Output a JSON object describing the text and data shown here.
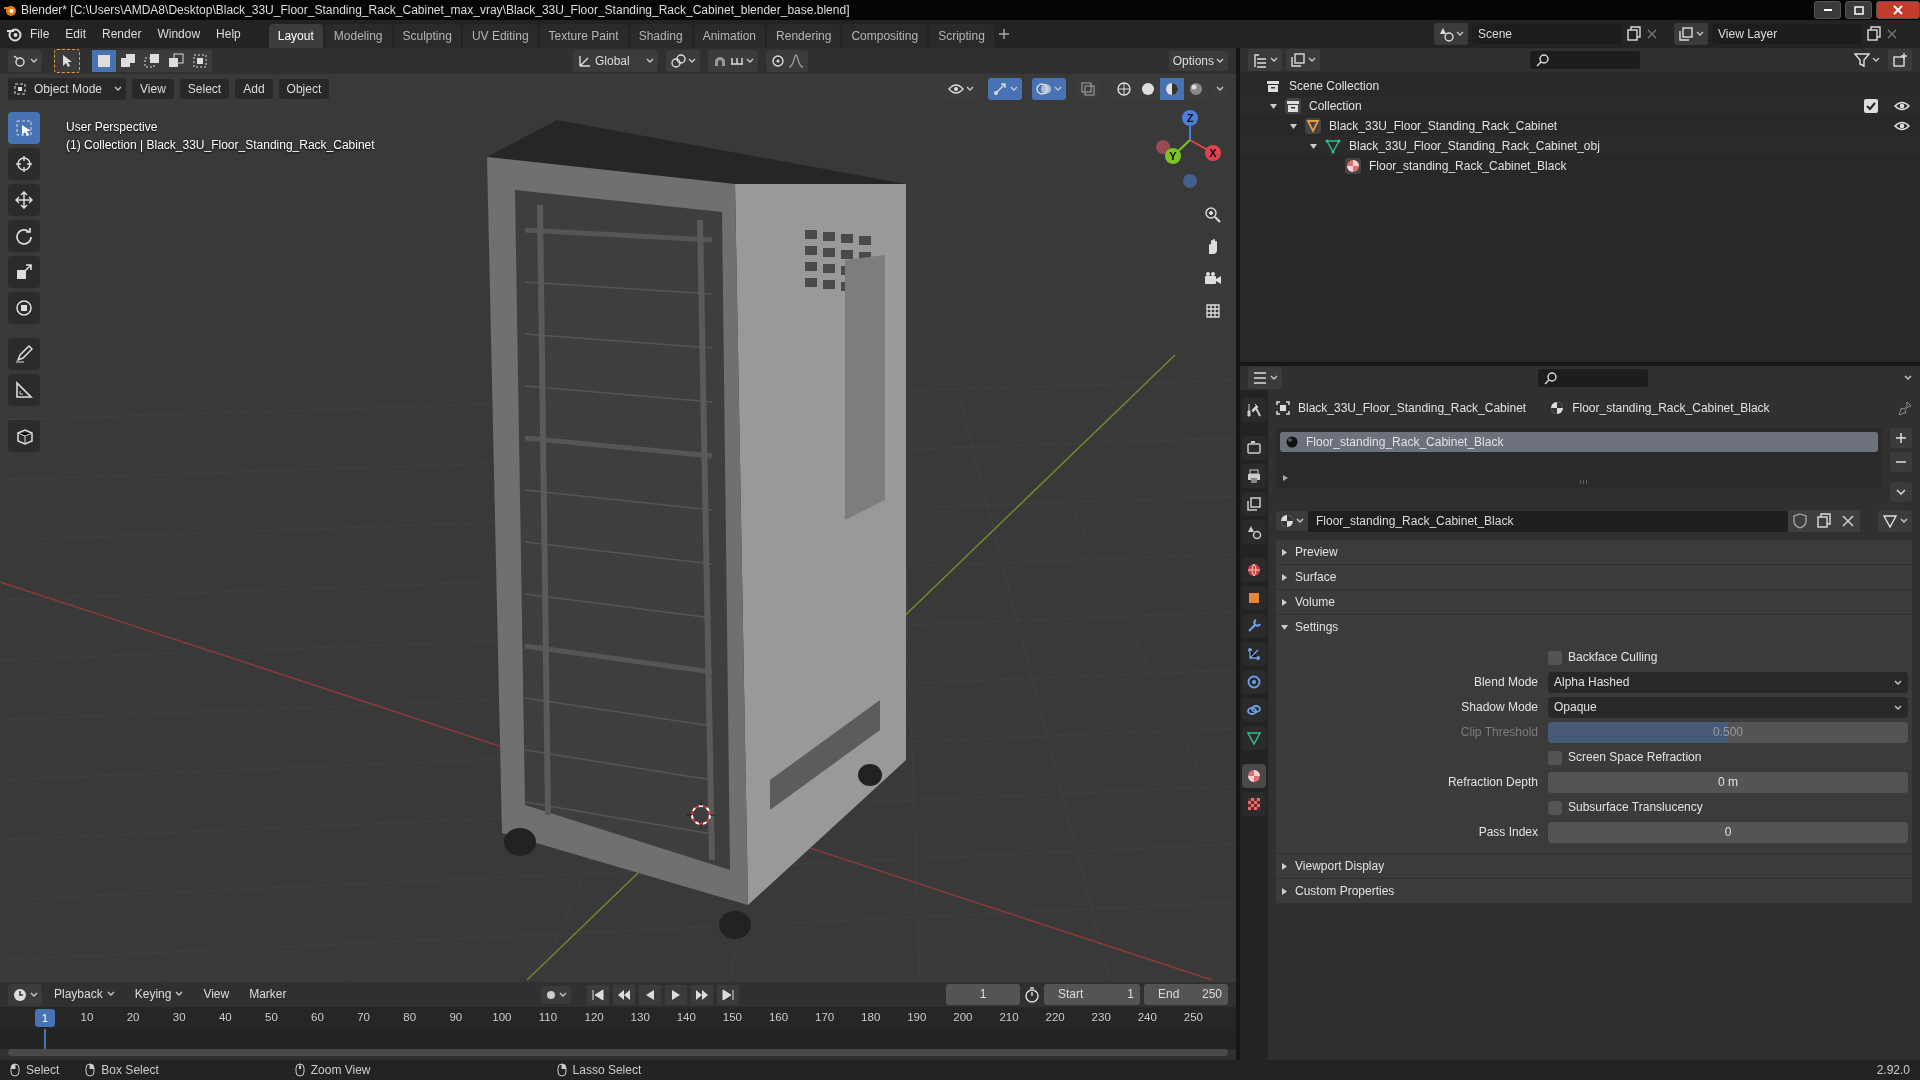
{
  "window": {
    "title": "Blender* [C:\\Users\\AMDA8\\Desktop\\Black_33U_Floor_Standing_Rack_Cabinet_max_vray\\Black_33U_Floor_Standing_Rack_Cabinet_blender_base.blend]"
  },
  "menu": [
    "File",
    "Edit",
    "Render",
    "Window",
    "Help"
  ],
  "workspaces": [
    {
      "label": "Layout",
      "selected": true
    },
    {
      "label": "Modeling",
      "selected": false
    },
    {
      "label": "Sculpting",
      "selected": false
    },
    {
      "label": "UV Editing",
      "selected": false
    },
    {
      "label": "Texture Paint",
      "selected": false
    },
    {
      "label": "Shading",
      "selected": false
    },
    {
      "label": "Animation",
      "selected": false
    },
    {
      "label": "Rendering",
      "selected": false
    },
    {
      "label": "Compositing",
      "selected": false
    },
    {
      "label": "Scripting",
      "selected": false
    }
  ],
  "scene": "Scene",
  "view_layer": "View Layer",
  "tool_header": {
    "select_modes": [
      {
        "kind": "set",
        "selected": true
      },
      {
        "kind": "extend",
        "selected": false
      },
      {
        "kind": "subtract",
        "selected": false
      },
      {
        "kind": "invert",
        "selected": false
      },
      {
        "kind": "intersect",
        "selected": false
      }
    ],
    "orientation": "Global",
    "options": "Options"
  },
  "viewport_header": {
    "mode": "Object Mode",
    "menus": [
      "View",
      "Select",
      "Add",
      "Object"
    ],
    "toggles": [
      {
        "kind": "visibility",
        "on": false
      },
      {
        "kind": "gizmo",
        "on": true
      },
      {
        "kind": "overlay",
        "on": true
      },
      {
        "kind": "xray",
        "on": false
      }
    ],
    "shading": [
      {
        "kind": "wireframe",
        "selected": false
      },
      {
        "kind": "solid",
        "selected": false
      },
      {
        "kind": "material",
        "selected": true
      },
      {
        "kind": "rendered",
        "selected": false
      }
    ]
  },
  "viewport": {
    "perspective": "User Perspective",
    "info": "(1) Collection | Black_33U_Floor_Standing_Rack_Cabinet",
    "axes": [
      "X",
      "Y",
      "Z"
    ]
  },
  "toolbar": [
    {
      "kind": "select",
      "selected": true
    },
    {
      "kind": "cursor",
      "selected": false
    },
    {
      "kind": "move",
      "selected": false
    },
    {
      "kind": "rotate",
      "selected": false
    },
    {
      "kind": "scale",
      "selected": false
    },
    {
      "kind": "transform",
      "selected": false
    },
    {
      "kind": "annotate",
      "selected": false
    },
    {
      "kind": "measure",
      "selected": false
    },
    {
      "kind": "add-cube",
      "selected": false
    }
  ],
  "outliner": {
    "tree": [
      {
        "label": "Scene Collection",
        "kind": "scene",
        "visible": false,
        "children": [
          {
            "label": "Collection",
            "kind": "collection",
            "expanded": true,
            "checked": true,
            "visible": true,
            "children": [
              {
                "label": "Black_33U_Floor_Standing_Rack_Cabinet",
                "kind": "object",
                "expanded": true,
                "visible": true,
                "children": [
                  {
                    "label": "Black_33U_Floor_Standing_Rack_Cabinet_obj",
                    "kind": "mesh",
                    "expanded": true,
                    "visible": false,
                    "children": [
                      {
                        "label": "Floor_standing_Rack_Cabinet_Black",
                        "kind": "material",
                        "visible": false
                      }
                    ]
                  }
                ]
              }
            ]
          }
        ]
      }
    ]
  },
  "properties": {
    "tabs": [
      {
        "kind": "tool",
        "selected": false
      },
      {
        "kind": "render",
        "selected": false
      },
      {
        "kind": "output",
        "selected": false
      },
      {
        "kind": "view-layer",
        "selected": false
      },
      {
        "kind": "scene",
        "selected": false
      },
      {
        "kind": "world",
        "selected": false
      },
      {
        "kind": "object",
        "selected": false
      },
      {
        "kind": "modifiers",
        "selected": false
      },
      {
        "kind": "particles",
        "selected": false
      },
      {
        "kind": "physics",
        "selected": false
      },
      {
        "kind": "constraints",
        "selected": false
      },
      {
        "kind": "data",
        "selected": false
      },
      {
        "kind": "material",
        "selected": true
      },
      {
        "kind": "texture",
        "selected": false
      }
    ],
    "breadcrumb": [
      "Black_33U_Floor_Standing_Rack_Cabinet",
      "Floor_standing_Rack_Cabinet_Black"
    ],
    "slots": [
      {
        "label": "Floor_standing_Rack_Cabinet_Black",
        "selected": true
      }
    ],
    "material": "Floor_standing_Rack_Cabinet_Black",
    "panels": [
      {
        "label": "Preview",
        "expanded": false
      },
      {
        "label": "Surface",
        "expanded": false
      },
      {
        "label": "Volume",
        "expanded": false
      },
      {
        "label": "Settings",
        "expanded": true,
        "rows": [
          {
            "kind": "checkbox",
            "label": "Backface Culling",
            "checked": false,
            "disabled": false
          },
          {
            "kind": "select",
            "label": "Blend Mode",
            "value": "Alpha Hashed",
            "disabled": false
          },
          {
            "kind": "select",
            "label": "Shadow Mode",
            "value": "Opaque",
            "disabled": false
          },
          {
            "kind": "slider",
            "label": "Clip Threshold",
            "value": "0.500",
            "level": 0.5,
            "disabled": true
          },
          {
            "kind": "checkbox",
            "label": "Screen Space Refraction",
            "checked": false,
            "disabled": false
          },
          {
            "kind": "number",
            "label": "Refraction Depth",
            "value": "0 m",
            "disabled": false
          },
          {
            "kind": "checkbox",
            "label": "Subsurface Translucency",
            "checked": false,
            "disabled": false
          },
          {
            "kind": "number",
            "label": "Pass Index",
            "value": "0",
            "disabled": false
          }
        ]
      },
      {
        "label": "Viewport Display",
        "expanded": false
      },
      {
        "label": "Custom Properties",
        "expanded": false
      }
    ]
  },
  "timeline": {
    "menus": [
      "Playback",
      "Keying",
      "View",
      "Marker"
    ],
    "current_frame": "1",
    "start_label": "Start",
    "start": "1",
    "end_label": "End",
    "end": "250",
    "current_marker": "1",
    "ticks": [
      "10",
      "20",
      "30",
      "40",
      "50",
      "60",
      "70",
      "80",
      "90",
      "100",
      "110",
      "120",
      "130",
      "140",
      "150",
      "160",
      "170",
      "180",
      "190",
      "200",
      "210",
      "220",
      "230",
      "240",
      "250"
    ]
  },
  "status_bar": {
    "hints": [
      "Select",
      "Box Select",
      "Zoom View",
      "Lasso Select"
    ],
    "version": "2.92.0"
  }
}
